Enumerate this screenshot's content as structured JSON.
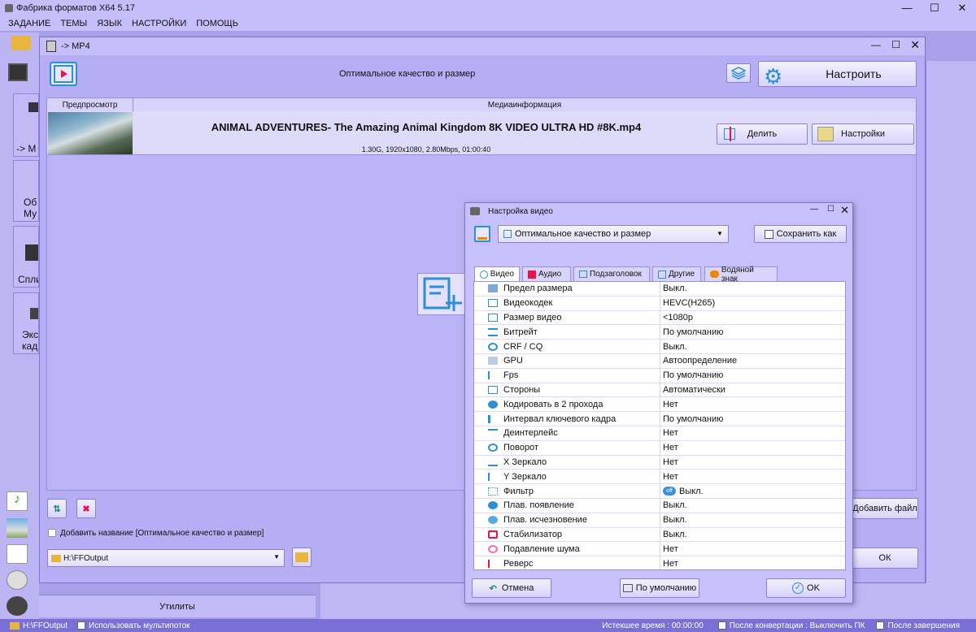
{
  "app": {
    "title": "Фабрика форматов X64 5.17",
    "menu": [
      "ЗАДАНИЕ",
      "ТЕМЫ",
      "ЯЗЫК",
      "НАСТРОЙКИ",
      "ПОМОЩЬ"
    ]
  },
  "sidebar": {
    "tile1": "-> M",
    "tile2a": "Об",
    "tile2b": "Му",
    "tile3": "Спли",
    "tile4a": "Экс",
    "tile4b": "кад",
    "utilities": "Утилиты"
  },
  "convert_window": {
    "title": "-> MP4",
    "profile": "Оптимальное качество и размер",
    "configure_label": "Настроить",
    "col_preview": "Предпросмотр",
    "col_media": "Медиаинформация",
    "file_name": "ANIMAL ADVENTURES- The Amazing Animal Kingdom 8K VIDEO ULTRA HD #8K.mp4",
    "file_info": "1.30G, 1920x1080, 2.80Mbps, 01:00:40",
    "split_label": "Делить",
    "settings_label": "Настройки",
    "add_name_label": "Добавить название [Оптимальное качество и размер]",
    "output_path": "H:\\FFOutput",
    "add_file_label": "Добавить файл",
    "ok_label": "ОК"
  },
  "dialog": {
    "title": "Настройка видео",
    "profile": "Оптимальное качество и размер",
    "save_as_label": "Сохранить как",
    "tabs": [
      "Видео",
      "Аудио",
      "Подзаголовок",
      "Другие",
      "Водяной знак"
    ],
    "rows": [
      {
        "name": "Предел размера",
        "value": "Выкл."
      },
      {
        "name": "Видеокодек",
        "value": "HEVC(H265)"
      },
      {
        "name": "Размер видео",
        "value": "<1080p"
      },
      {
        "name": "Битрейт",
        "value": "По умолчанию"
      },
      {
        "name": "CRF / CQ",
        "value": "Выкл."
      },
      {
        "name": "GPU",
        "value": "Автоопределение"
      },
      {
        "name": "Fps",
        "value": "По умолчанию"
      },
      {
        "name": "Стороны",
        "value": "Автоматически"
      },
      {
        "name": "Кодировать в 2 прохода",
        "value": "Нет"
      },
      {
        "name": "Интервал ключевого кадра",
        "value": "По умолчанию"
      },
      {
        "name": "Деинтерлейс",
        "value": "Нет"
      },
      {
        "name": "Поворот",
        "value": "Нет"
      },
      {
        "name": "X Зеркало",
        "value": "Нет"
      },
      {
        "name": "Y Зеркало",
        "value": "Нет"
      },
      {
        "name": "Фильтр",
        "value": "Выкл.",
        "toggle": "off"
      },
      {
        "name": "Плав. появление",
        "value": "Выкл."
      },
      {
        "name": "Плав. исчезновение",
        "value": "Выкл."
      },
      {
        "name": "Стабилизатор",
        "value": "Выкл."
      },
      {
        "name": "Подавление шума",
        "value": "Нет"
      },
      {
        "name": "Реверс",
        "value": "Нет"
      }
    ],
    "cancel_label": "Отмена",
    "default_label": "По умолчанию",
    "ok_label": "OK"
  },
  "statusbar": {
    "path": "H:\\FFOutput",
    "multithread": "Использовать мультипоток",
    "elapsed": "Истекшее время : 00:00:00",
    "after_convert": "После конвертации : Выключить ПК",
    "after_finish": "После завершения"
  },
  "colors": {
    "accent": "#2a8fd6",
    "window_bg": "#b3aaf2",
    "dialog_bg": "#c7c0fa"
  }
}
